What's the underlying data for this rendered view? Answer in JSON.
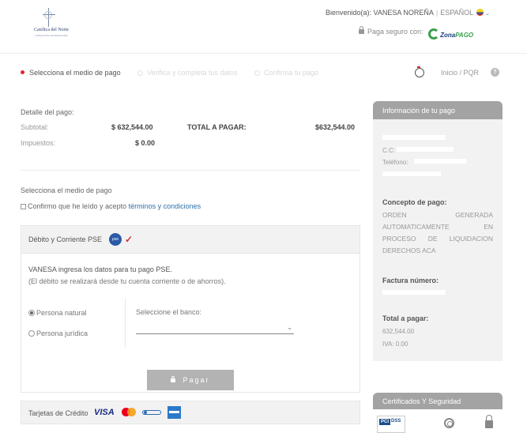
{
  "header": {
    "logo_text": "Católica del Norte",
    "logo_subtext": "FUNDACIÓN UNIVERSITARIA",
    "welcome_text": "Bienvenido(a): VANESA NOREÑA",
    "separator": "|",
    "language": "ESPAÑOL",
    "secure_text": "Paga seguro con:",
    "brand_zona": "Zona",
    "brand_pago": "PAGO"
  },
  "steps": {
    "step1": "Selecciona el medio de pago",
    "step2": "Verifica y completa tus datos",
    "step3": "Confirma tu pago",
    "nav_links": "Inicio  /  PQR"
  },
  "detail": {
    "title": "Detalle del pago:",
    "subtotal_label": "Subtotal:",
    "subtotal_value": "$ 632,544.00",
    "taxes_label": "Impuestos:",
    "taxes_value": "$ 0.00",
    "total_label": "TOTAL A PAGAR:",
    "total_value": "$632,544.00"
  },
  "method": {
    "title": "Selecciona el medio de pago",
    "terms_prefix": "Confirmo que he leído y acepto ",
    "terms_link": "términos y condiciones"
  },
  "pse": {
    "header_label": "Débito y Corriente PSE",
    "logo_text": "pse",
    "intro_line1": "VANESA ingresa los datos para tu pago PSE.",
    "intro_line2": "(El débito se realizará desde tu cuenta corriente o de ahorros).",
    "radio_natural": "Persona natural",
    "radio_juridica": "Persona jurídica",
    "natural_selected": true,
    "bank_label": "Seleccione el banco:",
    "bank_value": "",
    "pay_button": "Pagar"
  },
  "cards": {
    "label": "Tarjetas de Crédito",
    "visa": "VISA"
  },
  "sidebar": {
    "title": "Información de tu pago",
    "cc_label": "C.C:",
    "phone_label": "Teléfono:",
    "concept_label": "Concepto de pago:",
    "concept_lines": [
      [
        "ORDEN",
        "GENERADA"
      ],
      [
        "AUTOMATICAMENTE",
        "EN"
      ],
      [
        "PROCESO",
        "DE",
        "LIQUIDACION"
      ],
      [
        "DERECHOS ACA"
      ]
    ],
    "invoice_label": "Factura número:",
    "total_label": "Total a pagar:",
    "total_value": "632,544.00",
    "iva_value": "IVA: 0.00",
    "cert_title": "Certificados Y Seguridad"
  },
  "colors": {
    "accent_red": "#e3262a",
    "link_blue": "#2f6fa7",
    "sidebar_header": "#a3a3a3",
    "zona_green": "#3aa04d"
  }
}
